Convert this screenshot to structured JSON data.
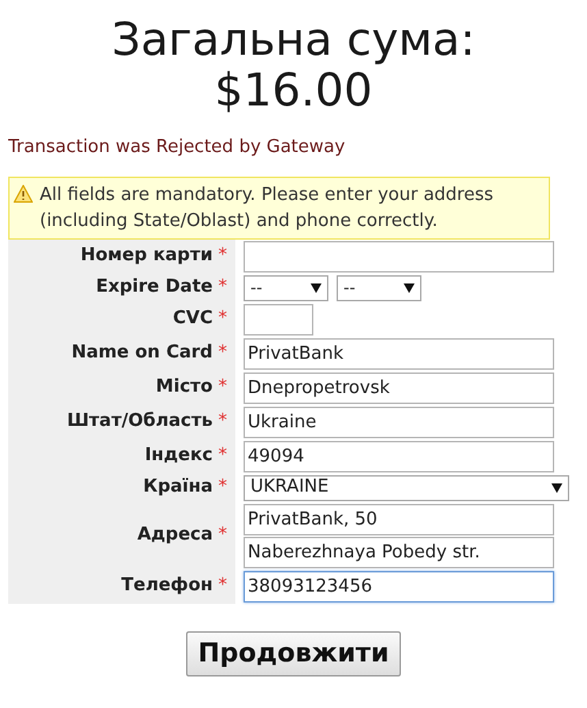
{
  "title": {
    "line_1": "Загальна сума:",
    "line_2": "$16.00"
  },
  "error_message": "Transaction was Rejected by Gateway",
  "warning": "All fields are mandatory. Please enter your address (including State/Oblast) and phone correctly.",
  "fields": [
    {
      "kind": "text",
      "label": "Номер карти",
      "required_mark": "*",
      "focused": false
    },
    {
      "kind": "select-pair",
      "label": "Expire Date",
      "required_mark": "*",
      "values": [
        "--",
        "--"
      ]
    },
    {
      "kind": "short-text",
      "label": "CVC",
      "required_mark": "*",
      "focused": false
    },
    {
      "kind": "text",
      "label": "Name on Card",
      "required_mark": "*",
      "values": [
        "PrivatBank"
      ],
      "focused": false
    },
    {
      "kind": "text",
      "label": "Місто",
      "required_mark": "*",
      "values": [
        "Dnepropetrovsk"
      ],
      "focused": false
    },
    {
      "kind": "text",
      "label": "Штат/Область",
      "required_mark": "*",
      "values": [
        "Ukraine"
      ],
      "focused": false
    },
    {
      "kind": "text",
      "label": "Індекс",
      "required_mark": "*",
      "values": [
        "49094"
      ],
      "focused": false
    },
    {
      "kind": "select",
      "label": "Країна",
      "required_mark": "*",
      "values": [
        "UKRAINE"
      ]
    },
    {
      "kind": "text",
      "label": "Адреса",
      "required_mark": "*",
      "values": [
        "PrivatBank, 50",
        "Naberezhnaya Pobedy str."
      ],
      "focused": false
    },
    {
      "kind": "text",
      "label": "Телефон",
      "required_mark": "*",
      "values": [
        "38093123456"
      ],
      "focused": true
    }
  ],
  "submit_button": "Продовжити"
}
